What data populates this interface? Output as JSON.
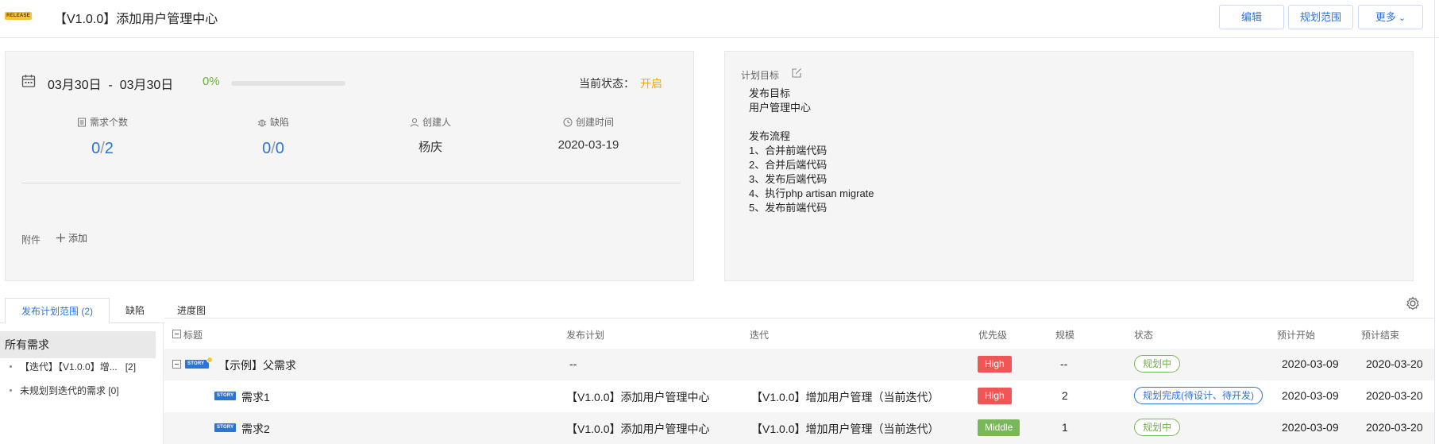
{
  "header": {
    "badge": "RELEASE",
    "title": "【V1.0.0】添加用户管理中心",
    "buttons": {
      "edit": "编辑",
      "scope": "规划范围",
      "more": "更多"
    }
  },
  "info": {
    "date_range": "03月30日  -  03月30日",
    "progress": "0%",
    "progress_value": 0,
    "status_label": "当前状态：",
    "status_value": "开启",
    "stats": [
      {
        "label": "需求个数",
        "done": "0",
        "total": "2",
        "icon": "list-icon"
      },
      {
        "label": "缺陷",
        "done": "0",
        "total": "0",
        "icon": "bug-icon"
      },
      {
        "label": "创建人",
        "value": "杨庆",
        "icon": "user-icon"
      },
      {
        "label": "创建时间",
        "value": "2020-03-19",
        "icon": "clock-icon"
      }
    ],
    "attach_label": "附件",
    "attach_add": "添加"
  },
  "goal": {
    "label": "计划目标",
    "lines": [
      "发布目标",
      "用户管理中心",
      "",
      "发布流程",
      "1、合并前端代码",
      "2、合并后端代码",
      "3、发布后端代码",
      "4、执行php artisan migrate",
      "5、发布前端代码"
    ]
  },
  "tabs": [
    "发布计划范围 (2)",
    "缺陷",
    "进度图"
  ],
  "tree": {
    "title": "所有需求",
    "items": [
      {
        "label": "【迭代】【V1.0.0】增...",
        "count": "[2]"
      },
      {
        "label": "未规划到迭代的需求 [0]",
        "count": ""
      }
    ]
  },
  "table": {
    "headers": [
      "标题",
      "发布计划",
      "迭代",
      "优先级",
      "规模",
      "状态",
      "预计开始",
      "预计结束"
    ],
    "rows": [
      {
        "tag": "STORY",
        "title": "【示例】父需求",
        "plan": "--",
        "iteration": "",
        "priority": "High",
        "size": "--",
        "status": "规划中",
        "start": "2020-03-09",
        "end": "2020-03-20"
      },
      {
        "tag": "STORY",
        "title": "需求1",
        "plan": "【V1.0.0】添加用户管理中心",
        "iteration": "【V1.0.0】增加用户管理（当前迭代）",
        "priority": "High",
        "size": "2",
        "status": "规划完成(待设计、待开发)",
        "start": "2020-03-09",
        "end": "2020-03-20"
      },
      {
        "tag": "STORY",
        "title": "需求2",
        "plan": "【V1.0.0】添加用户管理中心",
        "iteration": "【V1.0.0】增加用户管理（当前迭代）",
        "priority": "Middle",
        "size": "1",
        "status": "规划中",
        "start": "2020-03-09",
        "end": "2020-03-20"
      }
    ]
  }
}
